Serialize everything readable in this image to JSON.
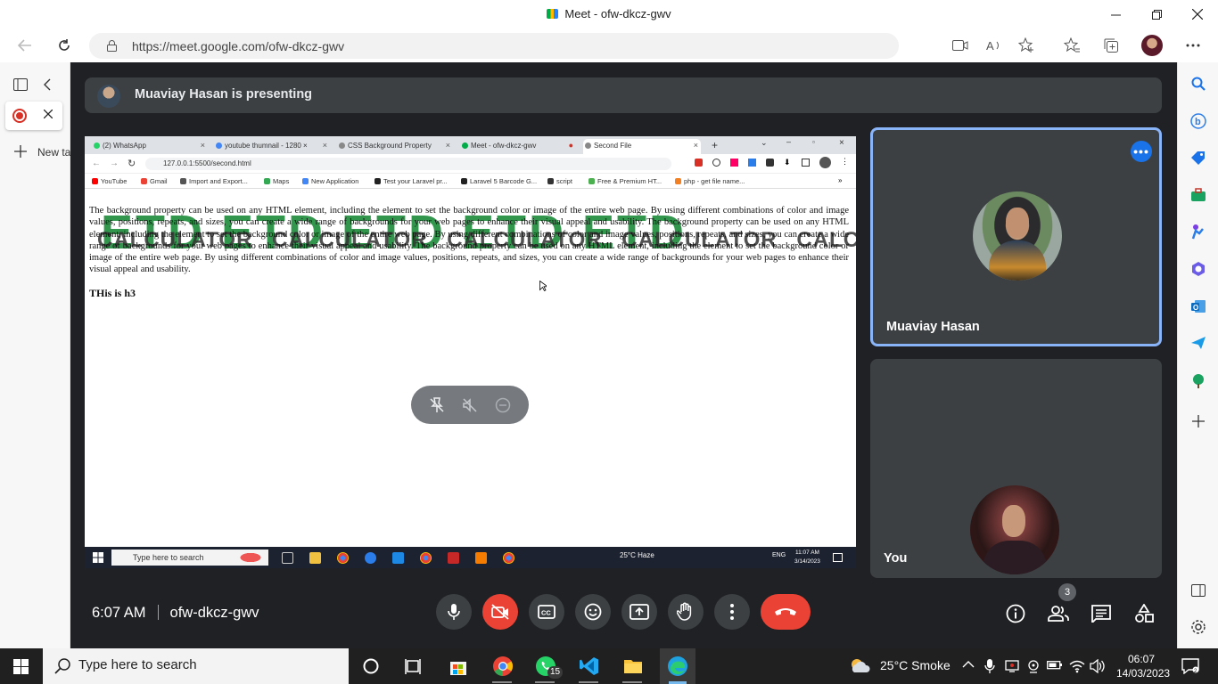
{
  "window": {
    "title": "Meet - ofw-dkcz-gwv"
  },
  "browser": {
    "url": "https://meet.google.com/ofw-dkcz-gwv",
    "new_tab_label": "New ta"
  },
  "meet": {
    "presenting_banner": "Muaviay Hasan is presenting",
    "time": "6:07 AM",
    "meeting_code": "ofw-dkcz-gwv",
    "participants_count": "3",
    "participants": [
      {
        "name": "Muaviay Hasan"
      },
      {
        "name": "You"
      }
    ]
  },
  "shared_screen": {
    "tabs": [
      {
        "label": "(2) WhatsApp",
        "color": "#25d366"
      },
      {
        "label": "youtube thumnail - 1280 ×",
        "color": "#4285f4"
      },
      {
        "label": "CSS Background Property",
        "color": "#888888"
      },
      {
        "label": "Meet - ofw-dkcz-gwv",
        "color": "#00ac47"
      },
      {
        "label": "Second File",
        "color": "#888888"
      }
    ],
    "url": "127.0.0.1:5500/second.html",
    "bookmarks": [
      {
        "label": "YouTube",
        "color": "#ff0000"
      },
      {
        "label": "Gmail",
        "color": "#ea4335"
      },
      {
        "label": "Import and Export...",
        "color": "#555555"
      },
      {
        "label": "Maps",
        "color": "#34a853"
      },
      {
        "label": "New Application",
        "color": "#4285f4"
      },
      {
        "label": "Test your Laravel pr...",
        "color": "#222222"
      },
      {
        "label": "Laravel 5 Barcode G...",
        "color": "#222222"
      },
      {
        "label": "script",
        "color": "#333333"
      },
      {
        "label": "Free & Premium HT...",
        "color": "#4caf50"
      },
      {
        "label": "php - get file name...",
        "color": "#f48024"
      }
    ],
    "bg_word_big": "ETD ETD ETD ETD ETD",
    "bg_word_small": "CALCULATOR CALCULATOR CALCULATOR CALCULATOR CALCULA",
    "paragraph": "The background property can be used on any HTML element, including the element to set the background color or image of the entire web page. By using different combinations of color and image values, positions, repeats, and sizes, you can create a wide range of backgrounds for your web pages to enhance their visual appeal and usability. The background property can be used on any HTML element, including the element to set the background color or image of the entire web page. By using different combinations of color and image values, positions, repeats, and sizes, you can create a wide range of backgrounds for your web pages to enhance their visual appeal and usability. The background property can be used on any HTML element, including the element to set the background color or image of the entire web page. By using different combinations of color and image values, positions, repeats, and sizes, you can create a wide range of backgrounds for your web pages to enhance their visual appeal and usability.",
    "heading": "THis is h3",
    "taskbar": {
      "search": "Type here to search",
      "weather": "25°C  Haze",
      "lang": "ENG",
      "time": "11:07 AM",
      "date": "3/14/2023"
    }
  },
  "taskbar": {
    "search_placeholder": "Type here to search",
    "whatsapp_badge": "15",
    "weather": "25°C  Smoke",
    "time": "06:07",
    "date": "14/03/2023"
  }
}
